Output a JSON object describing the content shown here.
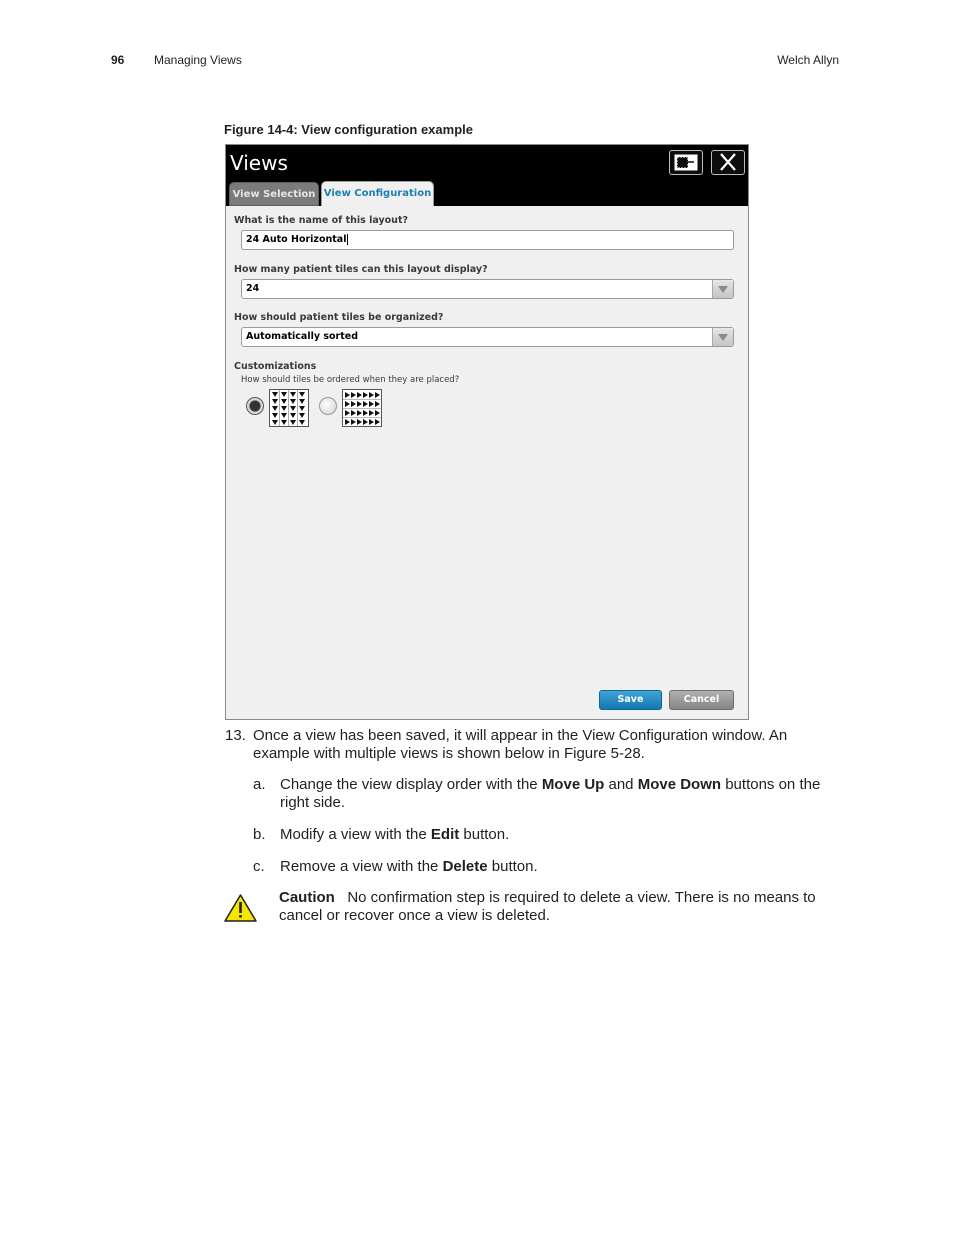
{
  "header": {
    "page_number": "96",
    "section": "Managing Views",
    "brand": "Welch Allyn"
  },
  "figure": {
    "caption": "Figure 14-4: View configuration example",
    "window": {
      "title": "Views",
      "tabs": [
        "View Selection",
        "View Configuration"
      ],
      "q_name": "What is the name of this layout?",
      "name_value": "24 Auto Horizontal",
      "q_tiles": "How many patient tiles can this layout display?",
      "tiles_value": "24",
      "q_organized": "How should patient tiles be organized?",
      "organized_value": "Automatically sorted",
      "customizations": "Customizations",
      "q_order": "How should tiles be ordered when they are placed?",
      "save_label": "Save",
      "cancel_label": "Cancel"
    }
  },
  "steps": {
    "step13_num": "13.",
    "step13_text": "Once a view has been saved, it will appear in the View Configuration window. An example with multiple views is shown below in Figure 5-28.",
    "a_letter": "a.",
    "a_pre": "Change the view display order with the ",
    "a_bold1": "Move Up",
    "a_mid": " and ",
    "a_bold2": "Move Down",
    "a_post": " buttons on the right side.",
    "b_letter": "b.",
    "b_pre": "Modify a view with the ",
    "b_bold": "Edit",
    "b_post": " button.",
    "c_letter": "c.",
    "c_pre": "Remove a view with the ",
    "c_bold": "Delete",
    "c_post": " button."
  },
  "caution": {
    "label": "Caution",
    "text": "No confirmation step is required to delete a view. There is no means to cancel or recover once a view is deleted."
  }
}
